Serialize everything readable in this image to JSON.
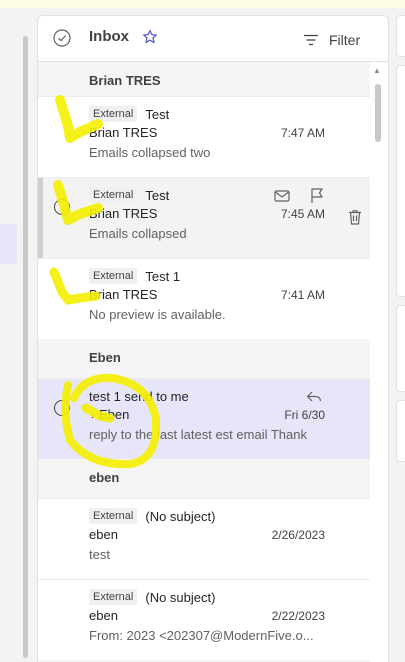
{
  "header": {
    "title": "Inbox",
    "filter_label": "Filter"
  },
  "groups": [
    {
      "name": "Brian TRES"
    },
    {
      "name": "Eben"
    },
    {
      "name": "eben"
    }
  ],
  "messages": [
    {
      "tag": "External",
      "subject": "Test",
      "sender": "Brian TRES",
      "time": "7:47 AM",
      "preview": "Emails collapsed two"
    },
    {
      "tag": "External",
      "subject": "Test",
      "sender": "Brian TRES",
      "time": "7:45 AM",
      "preview": "Emails collapsed"
    },
    {
      "tag": "External",
      "subject": "Test 1",
      "sender": "Brian TRES",
      "time": "7:41 AM",
      "preview": "No preview is available."
    },
    {
      "subject": "test 1 send to me",
      "sender": "Eben",
      "time": "Fri 6/30",
      "preview": "reply to the last latest est email Thank"
    },
    {
      "tag": "External",
      "subject": "(No subject)",
      "sender": "eben",
      "time": "2/26/2023",
      "preview": "test"
    },
    {
      "tag": "External",
      "subject": "(No subject)",
      "sender": "eben",
      "time": "2/22/2023",
      "preview": "From: 2023 <202307@ModernFive.o..."
    }
  ],
  "annotation_color": "#f5ef00"
}
